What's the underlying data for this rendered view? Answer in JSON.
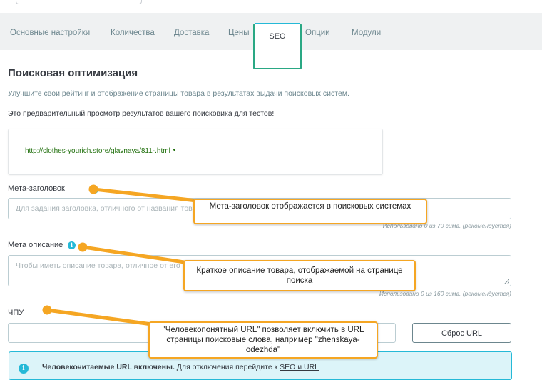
{
  "tabs": [
    {
      "label": "Основные настройки",
      "active": false
    },
    {
      "label": "Количества",
      "active": false
    },
    {
      "label": "Доставка",
      "active": false
    },
    {
      "label": "Цены",
      "active": false
    },
    {
      "label": "SEO",
      "active": true
    },
    {
      "label": "Опции",
      "active": false
    },
    {
      "label": "Модули",
      "active": false
    }
  ],
  "seo": {
    "title": "Поисковая оптимизация",
    "subtitle": "Улучшите свои рейтинг и отображение страницы товара в результатах выдачи поисковых систем.",
    "preview_note": "Это предварительный просмотр результатов вашего поисковика для тестов!",
    "preview_url": "http://clothes-yourich.store/glavnaya/811-.html",
    "meta_title": {
      "label": "Мета-заголовок",
      "placeholder": "Для задания заголовка, отличного от названия товара",
      "counter": "Использовано 0 из 70 симв. (рекомендуется)"
    },
    "meta_description": {
      "label": "Мета описание",
      "placeholder": "Чтобы иметь описание товара, отличное от его основного",
      "counter": "Использовано 0 из 160 симв. (рекомендуется)"
    },
    "friendly_url": {
      "label": "ЧПУ",
      "value": "",
      "reset_button": "Сброс URL"
    },
    "alert": {
      "bold": "Человекочитаемые URL включены.",
      "text": " Для отключения перейдите к ",
      "link": "SEO и URL"
    }
  },
  "callouts": {
    "meta_title": "Мета-заголовок отображается в поисковых системах",
    "meta_description": "Краткое описание товара, отображаемой на странице поиска",
    "friendly_url": "\"Человекопонятный URL\"  позволяет включить в URL страницы поисковые слова, например \"zhenskaya-odezhda\""
  },
  "colors": {
    "accent": "#25b9d7",
    "callout_border": "#f5a623",
    "tab_highlight": "#2aa884",
    "url_green": "#1e6e0a"
  }
}
